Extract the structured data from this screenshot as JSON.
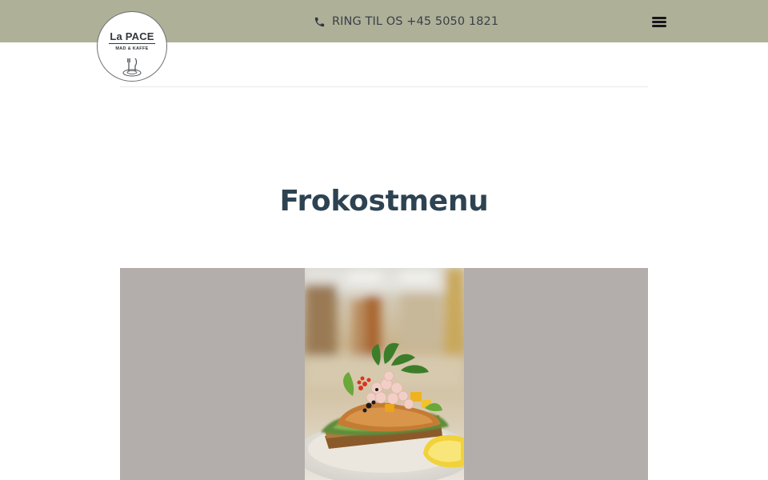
{
  "header": {
    "phone_label": "RING TIL OS +45 5050 1821",
    "icons": {
      "phone": "phone-icon",
      "menu": "hamburger-menu-icon"
    },
    "background_color": "#aeb098"
  },
  "logo": {
    "name": "La PACE",
    "tagline": "MAD & KAFFE",
    "icon": "cutlery-plate-icon"
  },
  "main": {
    "title": "Frokostmenu",
    "title_color": "#2e4352",
    "image": {
      "subject": "Open-faced sandwich with shrimp, salad and lemon",
      "backdrop_color": "#b3aeab"
    }
  }
}
